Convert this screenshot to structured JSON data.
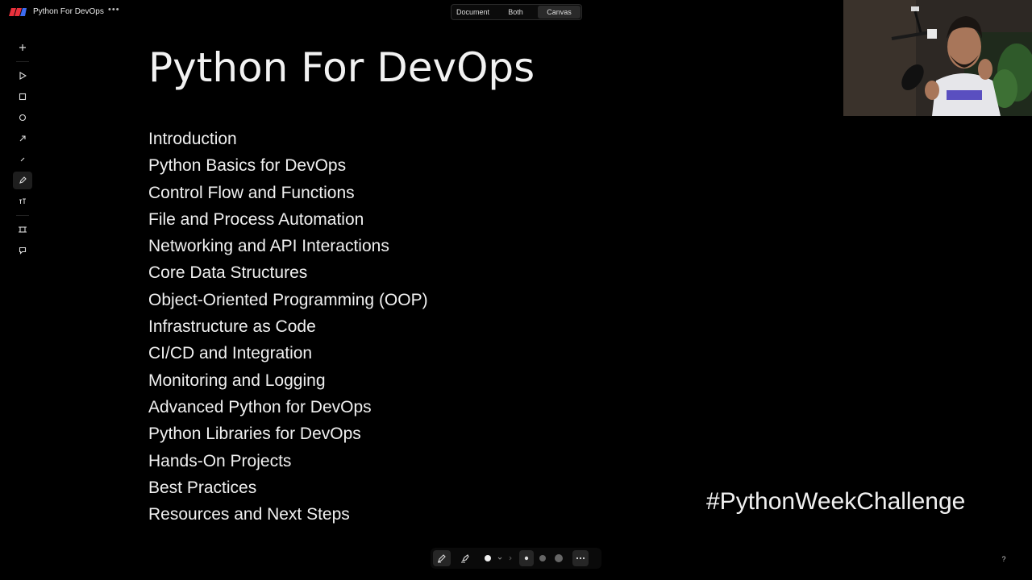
{
  "app": {
    "title": "Python For DevOps",
    "more_label": "•••"
  },
  "view_toggle": [
    {
      "label": "Document",
      "active": false
    },
    {
      "label": "Both",
      "active": false
    },
    {
      "label": "Canvas",
      "active": true
    }
  ],
  "toolbar": {
    "tools": [
      "add-icon",
      "pointer-icon",
      "rectangle-icon",
      "ellipse-icon",
      "arrow-icon",
      "line-icon",
      "pencil-icon",
      "text-icon",
      "frame-icon",
      "comment-icon"
    ],
    "active_tool": "pencil-icon"
  },
  "slide": {
    "title": "Python For DevOps",
    "topics": [
      "Introduction",
      "Python Basics for DevOps",
      "Control Flow and Functions",
      "File and Process Automation",
      "Networking and API Interactions",
      "Core Data Structures",
      "Object-Oriented Programming (OOP)",
      "Infrastructure as Code",
      "CI/CD and Integration",
      "Monitoring and Logging",
      "Advanced Python for DevOps",
      "Python Libraries for DevOps",
      "Hands-On Projects",
      "Best Practices",
      "Resources and Next Steps"
    ],
    "hashtag": "#PythonWeekChallenge"
  },
  "bottom_toolbar": {
    "tools": [
      "pen-icon",
      "highlighter-icon",
      "color-dot-icon",
      "chevron-down-icon",
      "stroke-small-icon",
      "stroke-medium-icon",
      "stroke-large-icon",
      "more-icon"
    ],
    "active": "pen-icon",
    "active_stroke": "stroke-small-icon"
  },
  "help": {
    "label": "?"
  },
  "colors": {
    "background": "#000000",
    "text": "#f0f0f0",
    "brand_red": "#e8313c"
  }
}
